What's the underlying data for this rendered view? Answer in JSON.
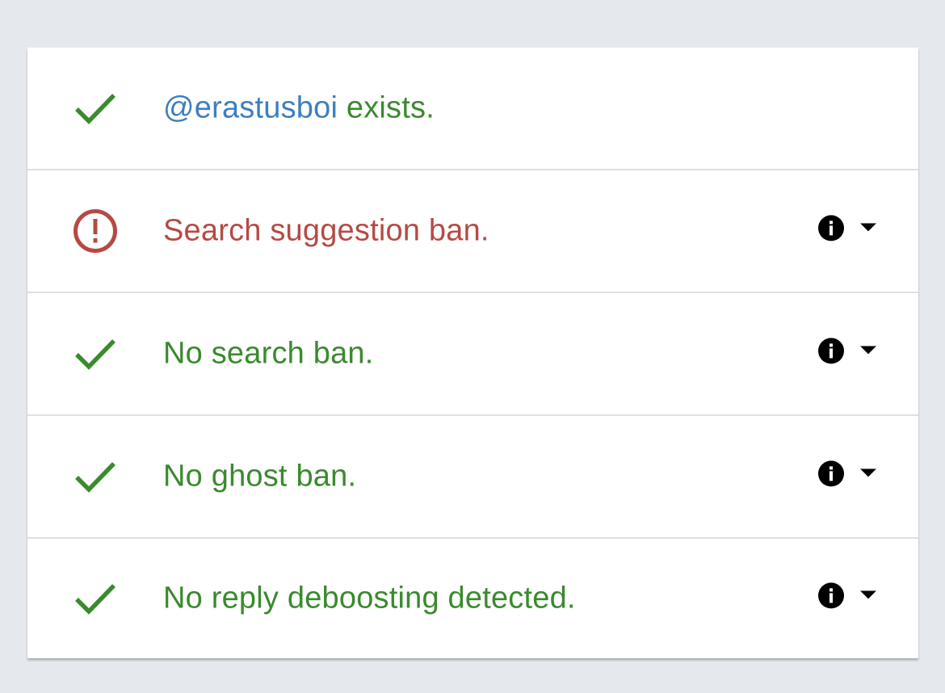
{
  "results": [
    {
      "status": "ok",
      "icon": "check-icon",
      "handle": "@erastusboi",
      "text": " exists.",
      "has_details": false
    },
    {
      "status": "warn",
      "icon": "alert-circle-icon",
      "text": "Search suggestion ban.",
      "has_details": true
    },
    {
      "status": "ok",
      "icon": "check-icon",
      "text": "No search ban.",
      "has_details": true
    },
    {
      "status": "ok",
      "icon": "check-icon",
      "text": "No ghost ban.",
      "has_details": true
    },
    {
      "status": "ok",
      "icon": "check-icon",
      "text": "No reply deboosting detected.",
      "has_details": true
    }
  ],
  "colors": {
    "ok": "#3a8a2e",
    "warn": "#b54a45",
    "handle": "#3d7fbe",
    "background": "#e5e9ee",
    "card": "#ffffff"
  },
  "icons": {
    "info": "info-icon",
    "expand": "caret-down-icon"
  }
}
